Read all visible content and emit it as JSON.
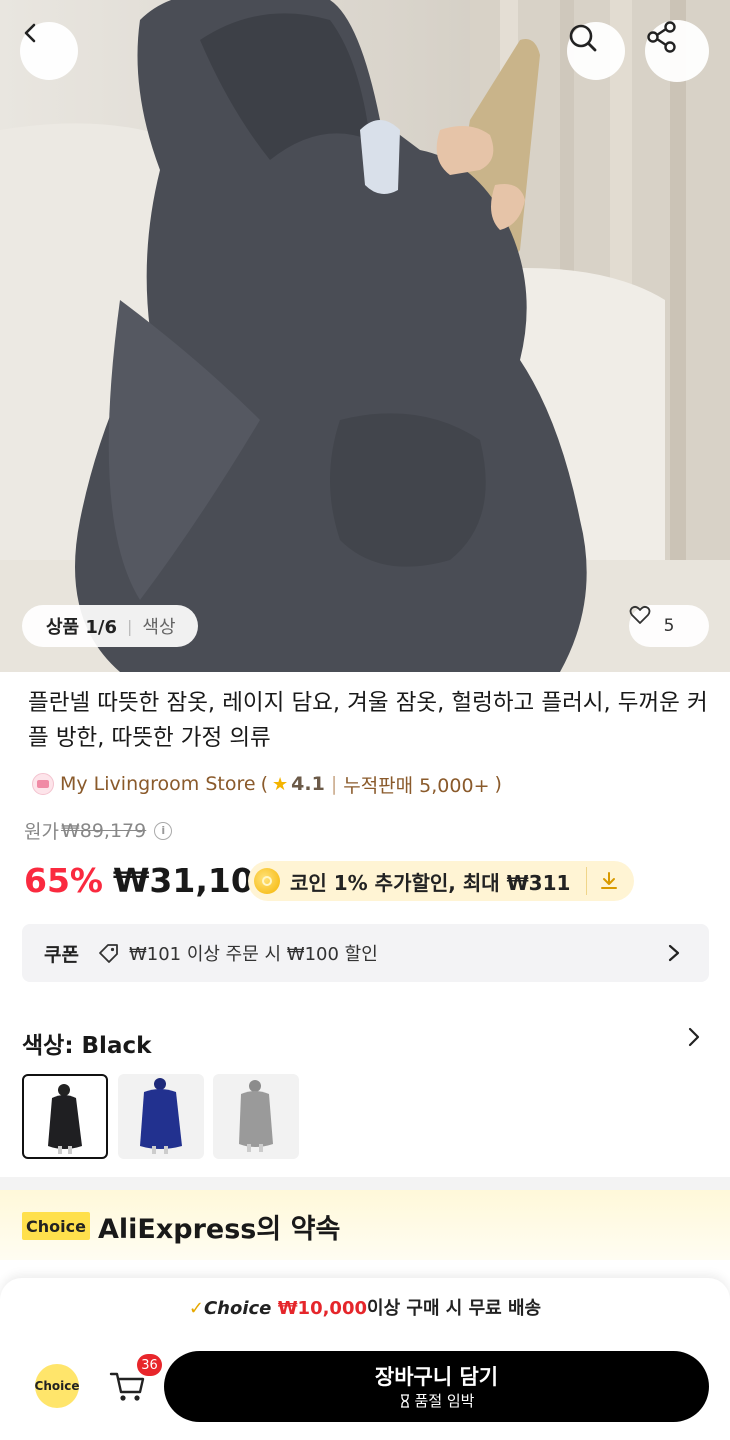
{
  "gallery": {
    "counter": "상품 1/6",
    "color_tab": "색상",
    "likes": "5"
  },
  "product": {
    "title": "플란넬 따뜻한 잠옷, 레이지 담요, 겨울 잠옷, 헐렁하고 플러시, 두꺼운 커플 방한, 따뜻한 가정 의류",
    "store": {
      "name": "My Livingroom Store",
      "open": "(",
      "rating": "4.1",
      "sales": "누적판매 5,000+",
      "close": ")"
    },
    "original_price_label": "원가",
    "original_price": "₩89,179",
    "discount": "65%",
    "price": "₩31,100",
    "coin_offer": "코인 1% 추가할인, 최대 ₩311"
  },
  "coupon": {
    "label": "쿠폰",
    "text": "₩101 이상 주문 시 ₩100 할인"
  },
  "color": {
    "title": "색상: Black",
    "options": [
      "Black",
      "Navy",
      "Gray"
    ],
    "selected": "Black"
  },
  "promise": {
    "badge": "Choice",
    "title": "AliExpress의 약속"
  },
  "bottom_bar": {
    "check": "✓",
    "choice_word": "Choice",
    "free_ship_amount": "₩10,000",
    "free_ship_text": "이상 구매 시 무료 배송",
    "choice_label": "Choice",
    "cart_count": "36",
    "add_to_cart": "장바구니 담기",
    "stock_note": "품절 임박"
  },
  "colors": {
    "price_red": "#fa2a3f",
    "choice_yellow": "#ffe04c",
    "store_brown": "#8a5a2b"
  }
}
